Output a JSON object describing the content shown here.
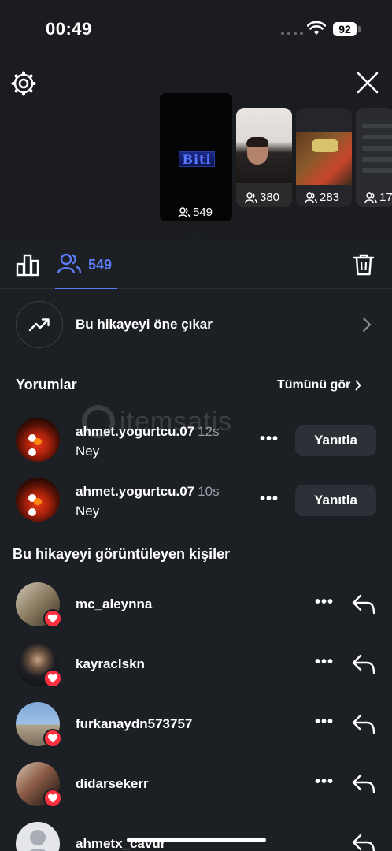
{
  "status_bar": {
    "time": "00:49",
    "battery": "92"
  },
  "stories": [
    {
      "label": "Biti",
      "viewers": "549"
    },
    {
      "viewers": "380"
    },
    {
      "viewers": "283"
    },
    {
      "viewers": "17"
    }
  ],
  "tabs": {
    "viewers_count": "549"
  },
  "promote": {
    "label": "Bu hikayeyi öne çıkar"
  },
  "comments_section": {
    "title": "Yorumlar",
    "see_all": "Tümünü gör",
    "items": [
      {
        "username": "ahmet.yogurtcu.07",
        "time": "12s",
        "text": "Ney",
        "reply": "Yanıtla"
      },
      {
        "username": "ahmet.yogurtcu.07",
        "time": "10s",
        "text": "Ney",
        "reply": "Yanıtla"
      }
    ]
  },
  "watermark": "itemsatis",
  "viewers_section": {
    "title": "Bu hikayeyi görüntüleyen kişiler",
    "items": [
      {
        "username": "mc_aleynna"
      },
      {
        "username": "kayraclskn"
      },
      {
        "username": "furkanaydn573757"
      },
      {
        "username": "didarsekerr"
      },
      {
        "username": "ahmetx_cavur"
      }
    ]
  },
  "icons": {
    "gear": "gear-icon",
    "close": "close-icon",
    "bars": "bar-chart-icon",
    "people": "people-icon",
    "trash": "trash-icon",
    "trend": "trending-up-icon",
    "chevron": "chevron-right-icon",
    "heart": "heart-icon",
    "reply": "reply-icon"
  },
  "colors": {
    "accent": "#5b7cf5",
    "heart": "#ff3040",
    "background": "#1c1f24"
  }
}
